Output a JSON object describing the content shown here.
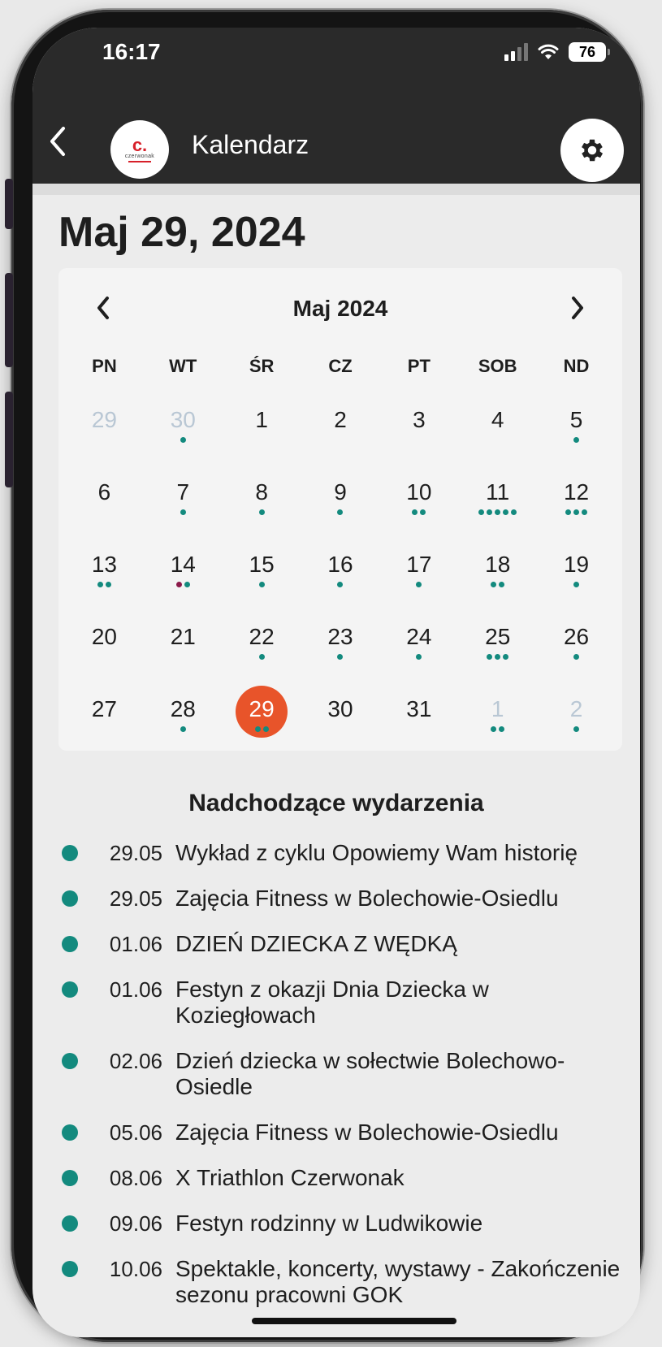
{
  "status_bar": {
    "time": "16:17",
    "battery": "76",
    "signal_icon": "signal-icon",
    "wifi_icon": "wifi-icon"
  },
  "app_bar": {
    "title": "Kalendarz",
    "logo_mark": "c.",
    "logo_text": "czerwonak",
    "back_icon": "chevron-left-icon",
    "settings_icon": "gear-icon"
  },
  "selected_date_heading": "Maj 29, 2024",
  "calendar": {
    "month_label": "Maj 2024",
    "prev_icon": "chevron-left-icon",
    "next_icon": "chevron-right-icon",
    "weekdays": [
      "PN",
      "WT",
      "ŚR",
      "CZ",
      "PT",
      "SOB",
      "ND"
    ],
    "selected_color": "#e8542a",
    "dot_color": "#138a7e",
    "dot_color_alt": "#8b1a4a",
    "days": [
      {
        "n": "29",
        "other": true,
        "dots": []
      },
      {
        "n": "30",
        "other": true,
        "dots": [
          "t"
        ]
      },
      {
        "n": "1",
        "dots": []
      },
      {
        "n": "2",
        "dots": []
      },
      {
        "n": "3",
        "dots": []
      },
      {
        "n": "4",
        "dots": []
      },
      {
        "n": "5",
        "dots": [
          "t"
        ]
      },
      {
        "n": "6",
        "dots": []
      },
      {
        "n": "7",
        "dots": [
          "t"
        ]
      },
      {
        "n": "8",
        "dots": [
          "t"
        ]
      },
      {
        "n": "9",
        "dots": [
          "t"
        ]
      },
      {
        "n": "10",
        "dots": [
          "t",
          "t"
        ]
      },
      {
        "n": "11",
        "dots": [
          "t",
          "t",
          "t",
          "t",
          "t"
        ]
      },
      {
        "n": "12",
        "dots": [
          "t",
          "t",
          "t"
        ]
      },
      {
        "n": "13",
        "dots": [
          "t",
          "t"
        ]
      },
      {
        "n": "14",
        "dots": [
          "m",
          "t"
        ]
      },
      {
        "n": "15",
        "dots": [
          "t"
        ]
      },
      {
        "n": "16",
        "dots": [
          "t"
        ]
      },
      {
        "n": "17",
        "dots": [
          "t"
        ]
      },
      {
        "n": "18",
        "dots": [
          "t",
          "t"
        ]
      },
      {
        "n": "19",
        "dots": [
          "t"
        ]
      },
      {
        "n": "20",
        "dots": []
      },
      {
        "n": "21",
        "dots": []
      },
      {
        "n": "22",
        "dots": [
          "t"
        ]
      },
      {
        "n": "23",
        "dots": [
          "t"
        ]
      },
      {
        "n": "24",
        "dots": [
          "t"
        ]
      },
      {
        "n": "25",
        "dots": [
          "t",
          "t",
          "t"
        ]
      },
      {
        "n": "26",
        "dots": [
          "t"
        ]
      },
      {
        "n": "27",
        "dots": []
      },
      {
        "n": "28",
        "dots": [
          "t"
        ]
      },
      {
        "n": "29",
        "selected": true,
        "dots": [
          "t",
          "t"
        ]
      },
      {
        "n": "30",
        "dots": []
      },
      {
        "n": "31",
        "dots": []
      },
      {
        "n": "1",
        "other": true,
        "dots": [
          "t",
          "t"
        ]
      },
      {
        "n": "2",
        "other": true,
        "dots": [
          "t"
        ]
      }
    ]
  },
  "events": {
    "title": "Nadchodzące wydarzenia",
    "items": [
      {
        "date": "29.05",
        "title": "Wykład z cyklu Opowiemy Wam historię"
      },
      {
        "date": "29.05",
        "title": "Zajęcia Fitness w Bolechowie-Osiedlu"
      },
      {
        "date": "01.06",
        "title": "DZIEŃ DZIECKA Z WĘDKĄ"
      },
      {
        "date": "01.06",
        "title": "Festyn z okazji Dnia Dziecka w Koziegłowach"
      },
      {
        "date": "02.06",
        "title": "Dzień dziecka w sołectwie Bolechowo-Osiedle"
      },
      {
        "date": "05.06",
        "title": "Zajęcia Fitness w Bolechowie-Osiedlu"
      },
      {
        "date": "08.06",
        "title": "X Triathlon Czerwonak"
      },
      {
        "date": "09.06",
        "title": "Festyn rodzinny w Ludwikowie"
      },
      {
        "date": "10.06",
        "title": "Spektakle, koncerty, wystawy - Zakończenie sezonu pracowni GOK"
      }
    ]
  }
}
